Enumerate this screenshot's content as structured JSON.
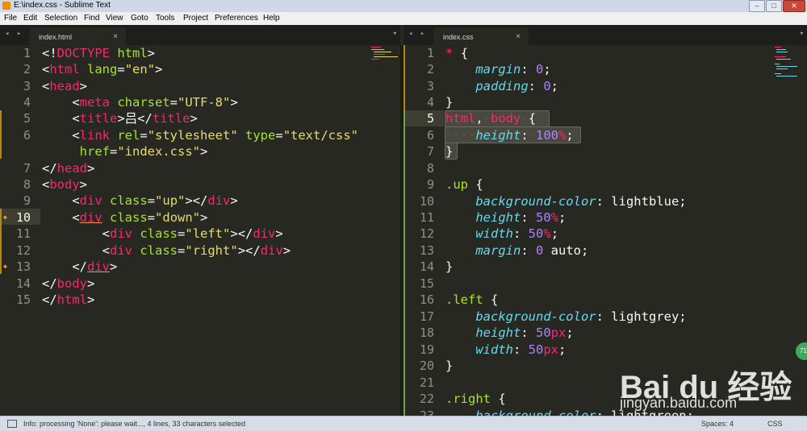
{
  "window": {
    "title": "E:\\index.css - Sublime Text",
    "minimize": "–",
    "maximize": "□",
    "close": "✕"
  },
  "menu": [
    "File",
    "Edit",
    "Selection",
    "Find",
    "View",
    "Goto",
    "Tools",
    "Project",
    "Preferences",
    "Help"
  ],
  "left_pane": {
    "tab": {
      "label": "index.html",
      "close": "×"
    },
    "nav": "◂ ▸",
    "dropdown": "▾",
    "line_numbers": [
      "1",
      "2",
      "3",
      "4",
      "5",
      "6",
      "",
      "7",
      "8",
      "9",
      "10",
      "11",
      "12",
      "13",
      "14",
      "15"
    ],
    "current_line": "10"
  },
  "right_pane": {
    "tab": {
      "label": "index.css",
      "close": "×"
    },
    "nav": "◂ ▸",
    "dropdown": "▾",
    "line_numbers": [
      "1",
      "2",
      "3",
      "4",
      "5",
      "6",
      "7",
      "8",
      "9",
      "10",
      "11",
      "12",
      "13",
      "14",
      "15",
      "16",
      "17",
      "18",
      "19",
      "20",
      "21",
      "22",
      "23"
    ],
    "current_line": "5"
  },
  "status": {
    "message": "Info: processing 'None': please wait..., 4 lines, 33 characters selected",
    "indentation": "Spaces: 4",
    "syntax": "CSS"
  },
  "watermark": {
    "brand": "Bai du 经验",
    "url": "jingyan.baidu.com"
  },
  "badge": "71",
  "colors": {
    "editor_bg": "#272822",
    "tag": "#f92672",
    "attribute": "#a6e22e",
    "string": "#e6db74",
    "property": "#66d9ef",
    "number": "#ae81ff"
  }
}
